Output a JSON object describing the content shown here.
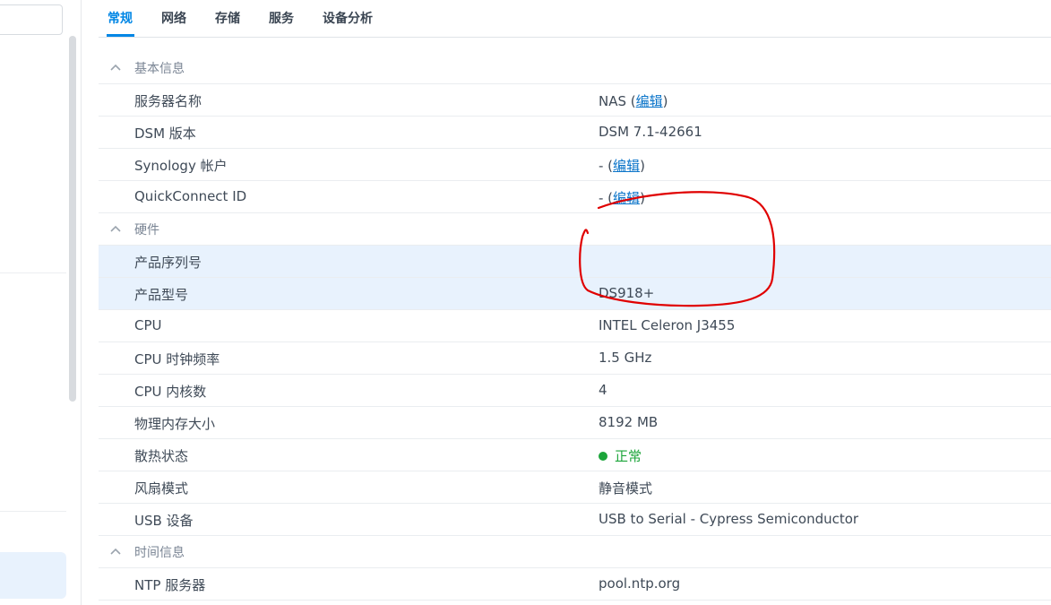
{
  "tabs": [
    {
      "label": "常规",
      "active": true
    },
    {
      "label": "网络",
      "active": false
    },
    {
      "label": "存储",
      "active": false
    },
    {
      "label": "服务",
      "active": false
    },
    {
      "label": "设备分析",
      "active": false
    }
  ],
  "sections": {
    "basic": {
      "title": "基本信息",
      "rows": {
        "server_name": {
          "key": "服务器名称",
          "value": "NAS (",
          "link": "编辑",
          "suffix": ")"
        },
        "dsm": {
          "key": "DSM 版本",
          "value": "DSM 7.1-42661"
        },
        "synology": {
          "key": "Synology 帐户",
          "value": "- (",
          "link": "编辑",
          "suffix": ")"
        },
        "quickconnect": {
          "key": "QuickConnect ID",
          "value": "- (",
          "link": "编辑",
          "suffix": ")"
        }
      }
    },
    "hardware": {
      "title": "硬件",
      "rows": {
        "serial": {
          "key": "产品序列号",
          "value": ""
        },
        "model": {
          "key": "产品型号",
          "value": "DS918+"
        },
        "cpu": {
          "key": "CPU",
          "value": "INTEL Celeron J3455"
        },
        "cpu_freq": {
          "key": "CPU 时钟频率",
          "value": "1.5 GHz"
        },
        "cpu_cores": {
          "key": "CPU 内核数",
          "value": "4"
        },
        "memory": {
          "key": "物理内存大小",
          "value": "8192 MB"
        },
        "thermal": {
          "key": "散热状态",
          "value": "正常"
        },
        "fan": {
          "key": "风扇模式",
          "value": "静音模式"
        },
        "usb": {
          "key": "USB 设备",
          "value": "USB to Serial - Cypress Semiconductor"
        }
      }
    },
    "time": {
      "title": "时间信息",
      "rows": {
        "ntp": {
          "key": "NTP 服务器",
          "value": "pool.ntp.org"
        }
      }
    }
  },
  "colors": {
    "accent": "#0086e5",
    "status_ok": "#1ca53a",
    "annotation": "#e00000",
    "row_highlight": "#e8f2fd"
  }
}
